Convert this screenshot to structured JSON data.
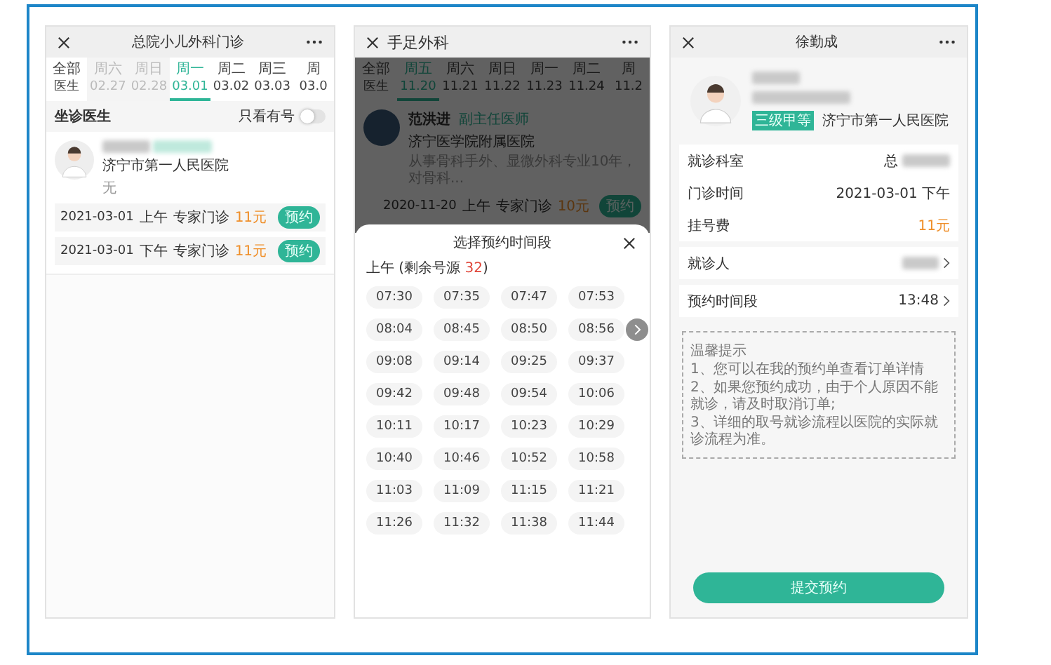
{
  "left_screen": {
    "title": "总院小儿外科门诊",
    "tabs": [
      {
        "line_1": "全部",
        "line_2": "医生",
        "selected": false,
        "disabled": false
      },
      {
        "line_1": "周六",
        "line_2": "02.27",
        "selected": false,
        "disabled": true
      },
      {
        "line_1": "周日",
        "line_2": "02.28",
        "selected": false,
        "disabled": true
      },
      {
        "line_1": "周一",
        "line_2": "03.01",
        "selected": true,
        "disabled": false
      },
      {
        "line_1": "周二",
        "line_2": "03.02",
        "selected": false,
        "disabled": false
      },
      {
        "line_1": "周三",
        "line_2": "03.03",
        "selected": false,
        "disabled": false
      },
      {
        "line_1": "周",
        "line_2": "03.0",
        "selected": false,
        "disabled": false
      }
    ],
    "section_title": "坐诊医生",
    "filter": {
      "label": "只看有号",
      "on": false
    },
    "doctor": {
      "hospital": "济宁市第一人民医院",
      "note": "无",
      "slots": [
        {
          "date": "2021-03-01",
          "period": "上午",
          "type": "专家门诊",
          "fee": "11元",
          "button": "预约"
        },
        {
          "date": "2021-03-01",
          "period": "下午",
          "type": "专家门诊",
          "fee": "11元",
          "button": "预约"
        }
      ]
    }
  },
  "middle_screen": {
    "title": "手足外科",
    "tabs": [
      {
        "line_1": "全部",
        "line_2": "医生",
        "selected": false,
        "disabled": false
      },
      {
        "line_1": "周五",
        "line_2": "11.20",
        "selected": true,
        "disabled": false
      },
      {
        "line_1": "周六",
        "line_2": "11.21",
        "selected": false,
        "disabled": false
      },
      {
        "line_1": "周日",
        "line_2": "11.22",
        "selected": false,
        "disabled": false
      },
      {
        "line_1": "周一",
        "line_2": "11.23",
        "selected": false,
        "disabled": false
      },
      {
        "line_1": "周二",
        "line_2": "11.24",
        "selected": false,
        "disabled": false
      },
      {
        "line_1": "周",
        "line_2": "11.2",
        "selected": false,
        "disabled": false
      }
    ],
    "doctor": {
      "name": "范洪进",
      "rank": "副主任医师",
      "hospital": "济宁医学院附属医院",
      "intro": "从事骨科手外、显微外科专业10年，对骨科...",
      "slots": [
        {
          "date": "2020-11-20",
          "period": "上午",
          "type": "专家门诊",
          "fee": "10元",
          "button": "预约"
        }
      ]
    },
    "sheet": {
      "title": "选择预约时间段",
      "remaining": {
        "prefix": "上午 (剩余号源 ",
        "count": "32",
        "suffix": ")"
      },
      "times": [
        "07:30",
        "07:35",
        "07:47",
        "07:53",
        "08:04",
        "08:45",
        "08:50",
        "08:56",
        "09:08",
        "09:14",
        "09:25",
        "09:37",
        "09:42",
        "09:48",
        "09:54",
        "10:06",
        "10:11",
        "10:17",
        "10:23",
        "10:29",
        "10:40",
        "10:46",
        "10:52",
        "10:58",
        "11:03",
        "11:09",
        "11:15",
        "11:21",
        "11:26",
        "11:32",
        "11:38",
        "11:44"
      ]
    }
  },
  "right_screen": {
    "title": "徐勤成",
    "badge": "三级甲等",
    "hospital": "济宁市第一人民医院",
    "info_rows": [
      {
        "label": "就诊科室",
        "value": "总",
        "kind": "redacted"
      },
      {
        "label": "门诊时间",
        "value": "2021-03-01 下午",
        "kind": "text"
      },
      {
        "label": "挂号费",
        "value": "11元",
        "kind": "fee"
      }
    ],
    "link_rows": [
      {
        "label": "就诊人",
        "value": "",
        "kind": "redacted"
      },
      {
        "label": "预约时间段",
        "value": "13:48",
        "kind": "text"
      }
    ],
    "notice": {
      "title": "温馨提示",
      "lines": [
        "1、您可以在我的预约单查看订单详情",
        "2、如果您预约成功，由于个人原因不能就诊，请及时取消订单;",
        "3、详细的取号就诊流程以医院的实际就诊流程为准。"
      ]
    },
    "submit": "提交预约"
  }
}
